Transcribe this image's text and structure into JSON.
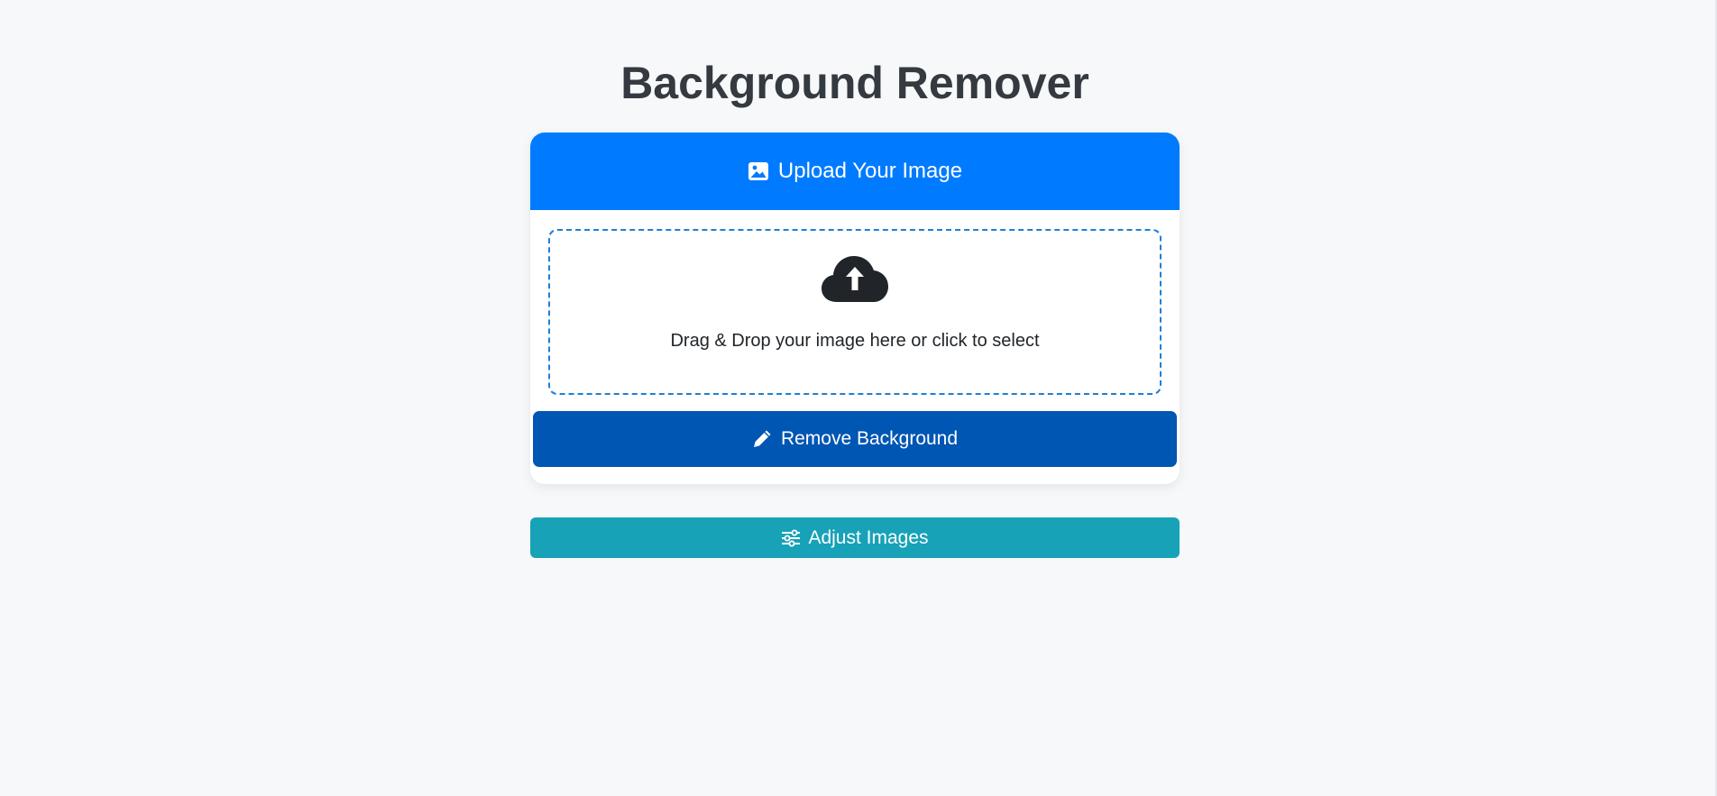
{
  "page": {
    "title": "Background Remover"
  },
  "upload_card": {
    "header_label": "Upload Your Image",
    "header_icon": "image-icon",
    "dropzone_text": "Drag & Drop your image here or click to select",
    "dropzone_icon": "cloud-upload-icon",
    "remove_button_label": "Remove Background",
    "remove_button_icon": "pencil-icon"
  },
  "adjust": {
    "button_label": "Adjust Images",
    "button_icon": "sliders-icon"
  },
  "colors": {
    "header_blue": "#007bff",
    "remove_button": "#0056b3",
    "adjust_button": "#17a2b8",
    "title_text": "#343a40",
    "dropzone_border": "#1e7fd6"
  }
}
